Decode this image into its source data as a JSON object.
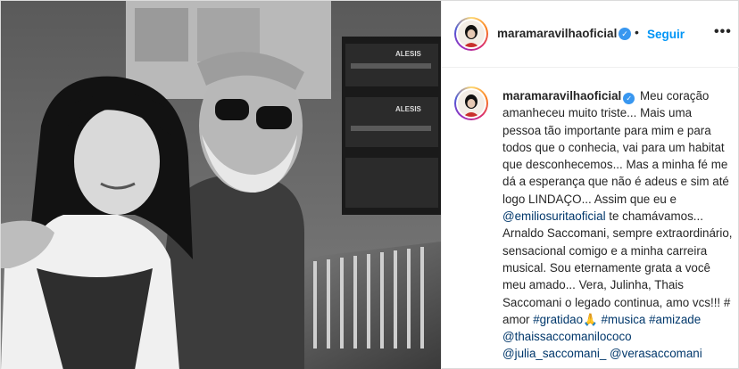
{
  "post": {
    "username": "maramaravilhaoficial",
    "follow_label": "Seguir",
    "separator": "•",
    "more_label": "•••",
    "verified_mark": "✓"
  },
  "photo": {
    "equipment_label_1": "ALESIS",
    "equipment_label_2": "ALESIS"
  },
  "caption": {
    "username": "maramaravilhaoficial",
    "text_1": " Meu coração amanheceu muito triste... Mais uma pessoa tão importante para mim e para todos que o conhecia, vai para um habitat que desconhecemos... Mas a minha fé me dá a esperança que não é adeus e sim até logo LINDAÇO... Assim que eu e ",
    "mention_1": "@emiliosuritaoficial",
    "text_2": " te chamávamos... Arnaldo Saccomani, sempre extraordinário, sensacional comigo e a minha carreira musical. Sou eternamente grata a você meu amado... Vera, Julinha, Thais Saccomani o legado continua, amo vcs!!! # amor ",
    "hashtag_1": "#gratidao🙏",
    "hashtag_2": "#musica",
    "hashtag_3": "#amizade",
    "mention_2": "@thaissaccomanilococo",
    "mention_3": "@julia_saccomani_",
    "mention_4": "@verasaccomani"
  },
  "colors": {
    "link_blue": "#0095f6",
    "mention_blue": "#00376b",
    "verified_blue": "#3897f0",
    "text": "#262626",
    "border": "#dbdbdb"
  },
  "icons": [
    "verified-badge-icon",
    "more-options-icon",
    "avatar-icon"
  ]
}
